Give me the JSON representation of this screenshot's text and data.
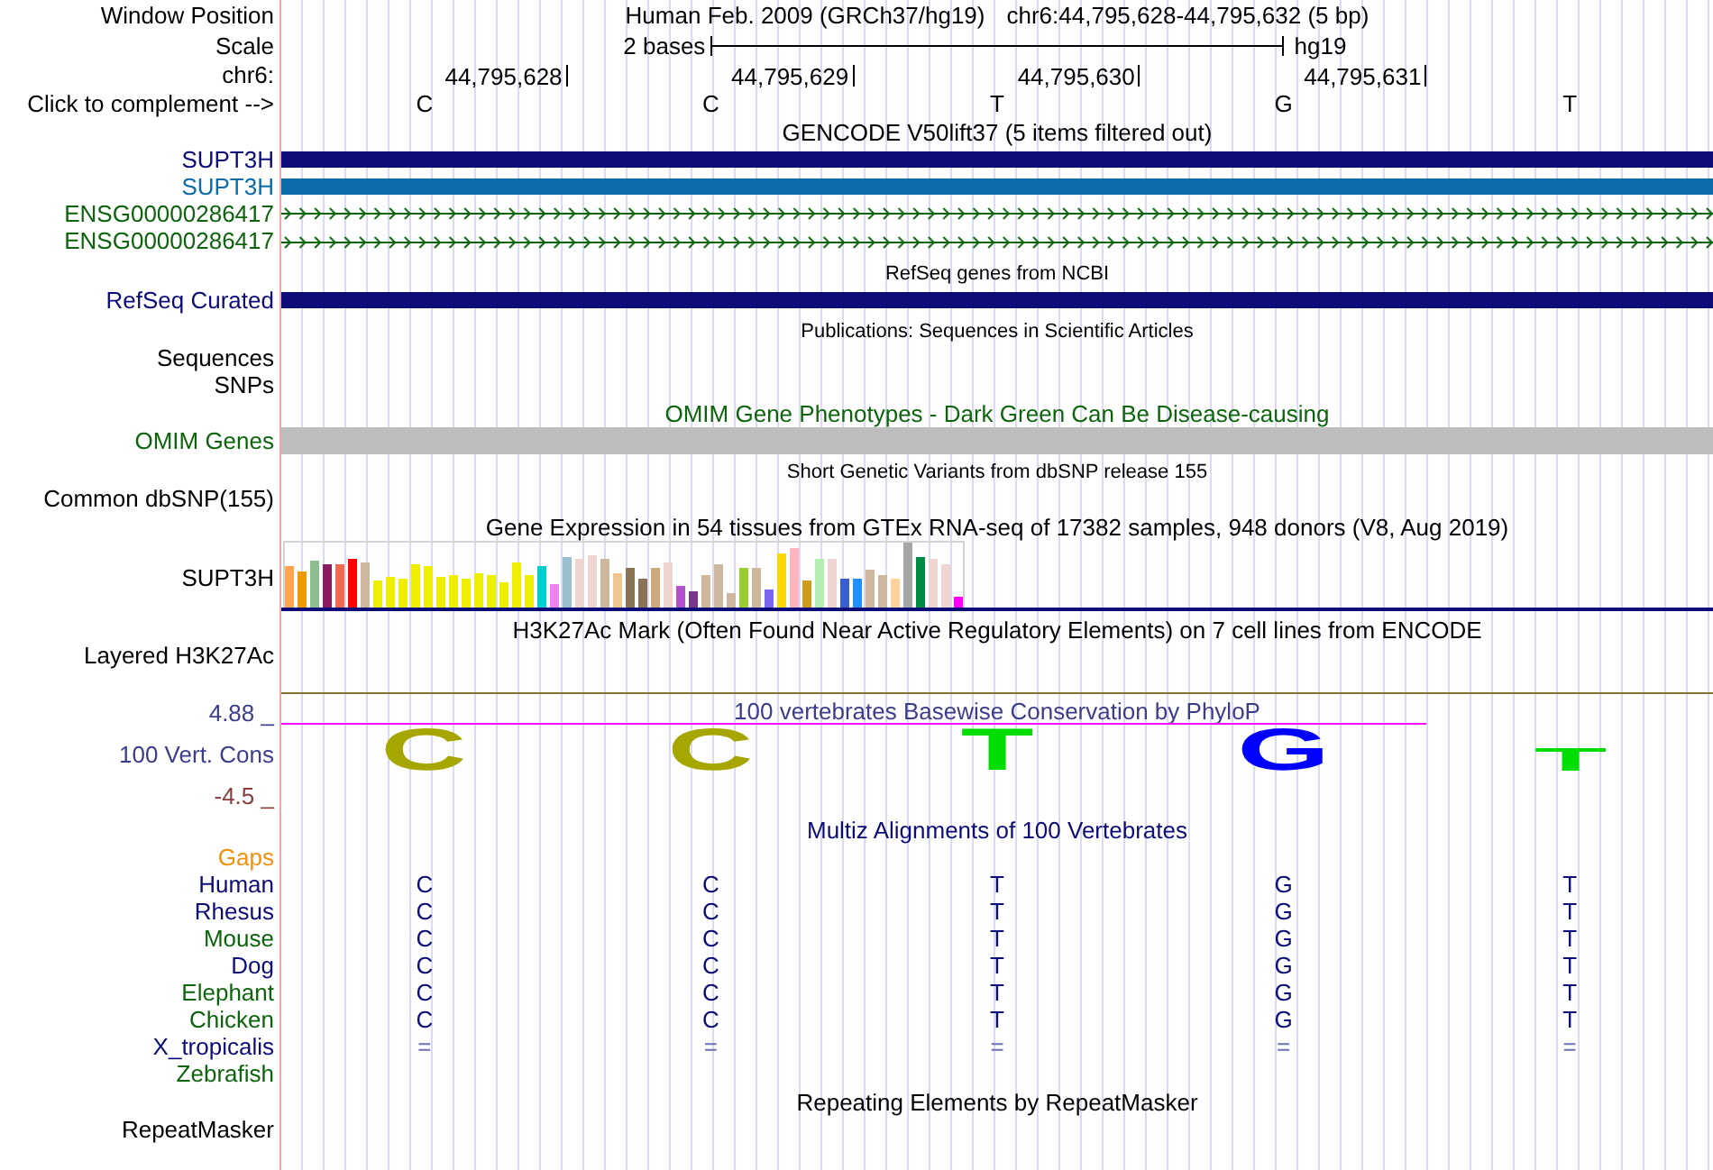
{
  "header": {
    "window_position": {
      "label": "Window Position",
      "assembly": "Human Feb. 2009 (GRCh37/hg19)",
      "position": "chr6:44,795,628-44,795,632 (5 bp)"
    },
    "scale": {
      "label": "Scale",
      "span": "2 bases",
      "assembly": "hg19"
    },
    "chromosome": {
      "label": "chr6:",
      "positions": [
        "44,795,628",
        "44,795,629",
        "44,795,630",
        "44,795,631"
      ]
    },
    "complement": {
      "label": "Click to complement -->",
      "bases": [
        "C",
        "C",
        "T",
        "G",
        "T"
      ]
    }
  },
  "tracks": [
    {
      "kind": "title",
      "text": "GENCODE V50lift37 (5 items filtered out)"
    },
    {
      "kind": "gene",
      "label": "SUPT3H",
      "color": "#0c0c78",
      "feature": {
        "color": "#0c0c78"
      }
    },
    {
      "kind": "gene",
      "label": "SUPT3H",
      "color": "#0c6ca8",
      "feature": {
        "color": "#0c6ca8"
      }
    },
    {
      "kind": "chevrons",
      "label": "ENSG00000286417",
      "color": "#0c640c",
      "feature": {
        "color": "#0c640c"
      }
    },
    {
      "kind": "chevrons",
      "label": "ENSG00000286417",
      "color": "#0c640c",
      "feature": {
        "color": "#0c640c"
      }
    },
    {
      "kind": "caption",
      "text": "RefSeq genes from NCBI"
    },
    {
      "kind": "gene",
      "label": "RefSeq Curated",
      "color": "#0c0c78",
      "feature": {
        "color": "#0c0c78"
      }
    },
    {
      "kind": "caption",
      "text": "Publications: Sequences in Scientific Articles"
    },
    {
      "kind": "label",
      "label": "Sequences"
    },
    {
      "kind": "label",
      "label": "SNPs"
    },
    {
      "kind": "title",
      "text": "OMIM Gene Phenotypes - Dark Green Can Be Disease-causing",
      "color": "#0c640c"
    },
    {
      "kind": "block",
      "label": "OMIM Genes",
      "color": "#0c640c",
      "feature": {
        "color": "#bebebe"
      }
    },
    {
      "kind": "caption",
      "text": "Short Genetic Variants from dbSNP release 155"
    },
    {
      "kind": "label",
      "label": "Common dbSNP(155)"
    },
    {
      "kind": "title",
      "text": "Gene Expression in 54 tissues from GTEx RNA-seq of 17382 samples, 948 donors (V8, Aug 2019)"
    },
    {
      "kind": "expression",
      "label": "SUPT3H"
    },
    {
      "kind": "title",
      "text": "H3K27Ac Mark (Often Found Near Active Regulatory Elements) on 7 cell lines from ENCODE"
    },
    {
      "kind": "signal",
      "label": "Layered H3K27Ac",
      "feature": {
        "color": "#857235"
      }
    },
    {
      "kind": "conservation",
      "label": "100 Vert. Cons",
      "color": "#3c3c8c",
      "max_label": {
        "text": "4.88 _",
        "color": "#3c3c8c"
      },
      "min_label": {
        "text": "-4.5 _",
        "color": "#8c3c3c"
      },
      "title": "100 vertebrates Basewise Conservation by PhyloP",
      "letters": [
        {
          "kind": "tall",
          "base": "C",
          "color": "#a6a600"
        },
        {
          "kind": "tall",
          "base": "C",
          "color": "#a6a600"
        },
        {
          "kind": "tall",
          "base": "T",
          "color": "#00dd00"
        },
        {
          "kind": "tall",
          "base": "G",
          "color": "#0000ff"
        },
        {
          "kind": "short",
          "base": "T",
          "color": "#00dd00"
        }
      ]
    },
    {
      "kind": "title",
      "text": "Multiz Alignments of 100 Vertebrates",
      "color": "#0c0c78"
    },
    {
      "kind": "label",
      "label": "Gaps",
      "color": "#f0900c"
    },
    {
      "kind": "species",
      "label": "Human",
      "color": "#0c0c78",
      "alignment": {
        "color": "#0c0c78",
        "bases": [
          "C",
          "C",
          "T",
          "G",
          "T"
        ]
      }
    },
    {
      "kind": "species",
      "label": "Rhesus",
      "color": "#0c0c78",
      "alignment": {
        "color": "#0c0c78",
        "bases": [
          "C",
          "C",
          "T",
          "G",
          "T"
        ]
      }
    },
    {
      "kind": "species",
      "label": "Mouse",
      "color": "#0c640c",
      "alignment": {
        "color": "#0c0c78",
        "bases": [
          "C",
          "C",
          "T",
          "G",
          "T"
        ]
      }
    },
    {
      "kind": "species",
      "label": "Dog",
      "color": "#0c0c78",
      "alignment": {
        "color": "#0c0c78",
        "bases": [
          "C",
          "C",
          "T",
          "G",
          "T"
        ]
      }
    },
    {
      "kind": "species",
      "label": "Elephant",
      "color": "#0c640c",
      "alignment": {
        "color": "#0c0c78",
        "bases": [
          "C",
          "C",
          "T",
          "G",
          "T"
        ]
      }
    },
    {
      "kind": "species",
      "label": "Chicken",
      "color": "#0c640c",
      "alignment": {
        "color": "#0c0c78",
        "bases": [
          "C",
          "C",
          "T",
          "G",
          "T"
        ]
      }
    },
    {
      "kind": "species",
      "label": "X_tropicalis",
      "color": "#0c0c78",
      "alignment": {
        "color": "#7070b8",
        "bases": [
          "=",
          "=",
          "=",
          "=",
          "="
        ]
      }
    },
    {
      "kind": "species",
      "label": "Zebrafish",
      "color": "#0c640c"
    },
    {
      "kind": "title",
      "text": "Repeating Elements by RepeatMasker"
    },
    {
      "kind": "label",
      "label": "RepeatMasker"
    }
  ]
}
